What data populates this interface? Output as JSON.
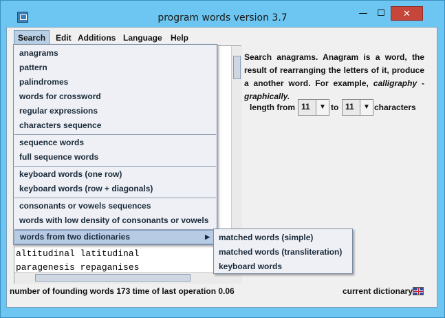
{
  "window": {
    "title": "program words version 3.7",
    "minimize_glyph": "—",
    "maximize_glyph": "☐",
    "close_glyph": "✕"
  },
  "menubar": {
    "items": [
      "Search",
      "Edit",
      "Additions",
      "Language",
      "Help"
    ],
    "active": "Search"
  },
  "search_menu": {
    "group1": [
      "anagrams",
      "pattern",
      "palindromes",
      "words for crossword",
      "regular expressions",
      "characters sequence"
    ],
    "group2": [
      "sequence words",
      "full sequence words"
    ],
    "group3": [
      "keyboard words (one row)",
      "keyboard words (row + diagonals)"
    ],
    "group4": [
      "consonants or vowels sequences",
      "words with low density of consonants or vowels"
    ],
    "group5": [
      "words from two dictionaries"
    ],
    "submenu_arrow": "▶"
  },
  "submenu": {
    "items": [
      "matched words (simple)",
      "matched words (transliteration)",
      "keyboard words"
    ]
  },
  "results": {
    "lines": [
      "altitudinal latitudinal",
      "paragenesis repaganises"
    ]
  },
  "description": {
    "text_before": "Search anagrams. Anagram is a word, the result of rearranging the letters of it, produce a another word. For example,",
    "example": "calligraphy - graphically.",
    "length_from_label": "length from",
    "to_label": "to",
    "characters_label": "characters",
    "from_value": "11",
    "to_value": "11",
    "combo_arrow": "▼"
  },
  "status": {
    "left": "number of founding words 173 time of last operation 0.06",
    "right": "current dictionary",
    "flag_icon": "uk-flag-icon"
  }
}
